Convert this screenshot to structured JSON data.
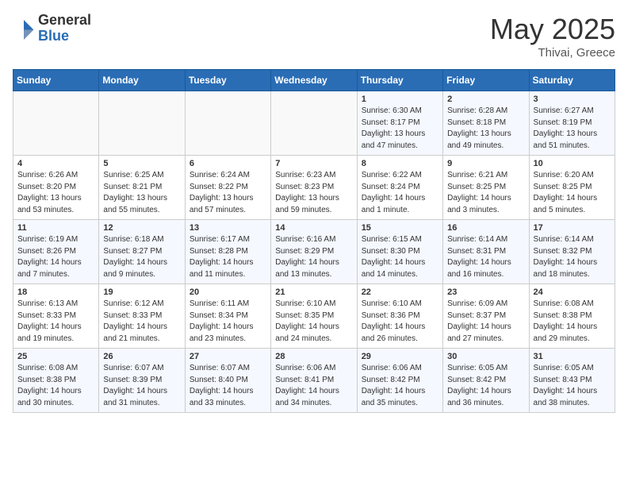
{
  "logo": {
    "general": "General",
    "blue": "Blue"
  },
  "title": {
    "month_year": "May 2025",
    "location": "Thivai, Greece"
  },
  "weekdays": [
    "Sunday",
    "Monday",
    "Tuesday",
    "Wednesday",
    "Thursday",
    "Friday",
    "Saturday"
  ],
  "weeks": [
    [
      {
        "day": "",
        "info": ""
      },
      {
        "day": "",
        "info": ""
      },
      {
        "day": "",
        "info": ""
      },
      {
        "day": "",
        "info": ""
      },
      {
        "day": "1",
        "info": "Sunrise: 6:30 AM\nSunset: 8:17 PM\nDaylight: 13 hours\nand 47 minutes."
      },
      {
        "day": "2",
        "info": "Sunrise: 6:28 AM\nSunset: 8:18 PM\nDaylight: 13 hours\nand 49 minutes."
      },
      {
        "day": "3",
        "info": "Sunrise: 6:27 AM\nSunset: 8:19 PM\nDaylight: 13 hours\nand 51 minutes."
      }
    ],
    [
      {
        "day": "4",
        "info": "Sunrise: 6:26 AM\nSunset: 8:20 PM\nDaylight: 13 hours\nand 53 minutes."
      },
      {
        "day": "5",
        "info": "Sunrise: 6:25 AM\nSunset: 8:21 PM\nDaylight: 13 hours\nand 55 minutes."
      },
      {
        "day": "6",
        "info": "Sunrise: 6:24 AM\nSunset: 8:22 PM\nDaylight: 13 hours\nand 57 minutes."
      },
      {
        "day": "7",
        "info": "Sunrise: 6:23 AM\nSunset: 8:23 PM\nDaylight: 13 hours\nand 59 minutes."
      },
      {
        "day": "8",
        "info": "Sunrise: 6:22 AM\nSunset: 8:24 PM\nDaylight: 14 hours\nand 1 minute."
      },
      {
        "day": "9",
        "info": "Sunrise: 6:21 AM\nSunset: 8:25 PM\nDaylight: 14 hours\nand 3 minutes."
      },
      {
        "day": "10",
        "info": "Sunrise: 6:20 AM\nSunset: 8:25 PM\nDaylight: 14 hours\nand 5 minutes."
      }
    ],
    [
      {
        "day": "11",
        "info": "Sunrise: 6:19 AM\nSunset: 8:26 PM\nDaylight: 14 hours\nand 7 minutes."
      },
      {
        "day": "12",
        "info": "Sunrise: 6:18 AM\nSunset: 8:27 PM\nDaylight: 14 hours\nand 9 minutes."
      },
      {
        "day": "13",
        "info": "Sunrise: 6:17 AM\nSunset: 8:28 PM\nDaylight: 14 hours\nand 11 minutes."
      },
      {
        "day": "14",
        "info": "Sunrise: 6:16 AM\nSunset: 8:29 PM\nDaylight: 14 hours\nand 13 minutes."
      },
      {
        "day": "15",
        "info": "Sunrise: 6:15 AM\nSunset: 8:30 PM\nDaylight: 14 hours\nand 14 minutes."
      },
      {
        "day": "16",
        "info": "Sunrise: 6:14 AM\nSunset: 8:31 PM\nDaylight: 14 hours\nand 16 minutes."
      },
      {
        "day": "17",
        "info": "Sunrise: 6:14 AM\nSunset: 8:32 PM\nDaylight: 14 hours\nand 18 minutes."
      }
    ],
    [
      {
        "day": "18",
        "info": "Sunrise: 6:13 AM\nSunset: 8:33 PM\nDaylight: 14 hours\nand 19 minutes."
      },
      {
        "day": "19",
        "info": "Sunrise: 6:12 AM\nSunset: 8:33 PM\nDaylight: 14 hours\nand 21 minutes."
      },
      {
        "day": "20",
        "info": "Sunrise: 6:11 AM\nSunset: 8:34 PM\nDaylight: 14 hours\nand 23 minutes."
      },
      {
        "day": "21",
        "info": "Sunrise: 6:10 AM\nSunset: 8:35 PM\nDaylight: 14 hours\nand 24 minutes."
      },
      {
        "day": "22",
        "info": "Sunrise: 6:10 AM\nSunset: 8:36 PM\nDaylight: 14 hours\nand 26 minutes."
      },
      {
        "day": "23",
        "info": "Sunrise: 6:09 AM\nSunset: 8:37 PM\nDaylight: 14 hours\nand 27 minutes."
      },
      {
        "day": "24",
        "info": "Sunrise: 6:08 AM\nSunset: 8:38 PM\nDaylight: 14 hours\nand 29 minutes."
      }
    ],
    [
      {
        "day": "25",
        "info": "Sunrise: 6:08 AM\nSunset: 8:38 PM\nDaylight: 14 hours\nand 30 minutes."
      },
      {
        "day": "26",
        "info": "Sunrise: 6:07 AM\nSunset: 8:39 PM\nDaylight: 14 hours\nand 31 minutes."
      },
      {
        "day": "27",
        "info": "Sunrise: 6:07 AM\nSunset: 8:40 PM\nDaylight: 14 hours\nand 33 minutes."
      },
      {
        "day": "28",
        "info": "Sunrise: 6:06 AM\nSunset: 8:41 PM\nDaylight: 14 hours\nand 34 minutes."
      },
      {
        "day": "29",
        "info": "Sunrise: 6:06 AM\nSunset: 8:42 PM\nDaylight: 14 hours\nand 35 minutes."
      },
      {
        "day": "30",
        "info": "Sunrise: 6:05 AM\nSunset: 8:42 PM\nDaylight: 14 hours\nand 36 minutes."
      },
      {
        "day": "31",
        "info": "Sunrise: 6:05 AM\nSunset: 8:43 PM\nDaylight: 14 hours\nand 38 minutes."
      }
    ]
  ]
}
